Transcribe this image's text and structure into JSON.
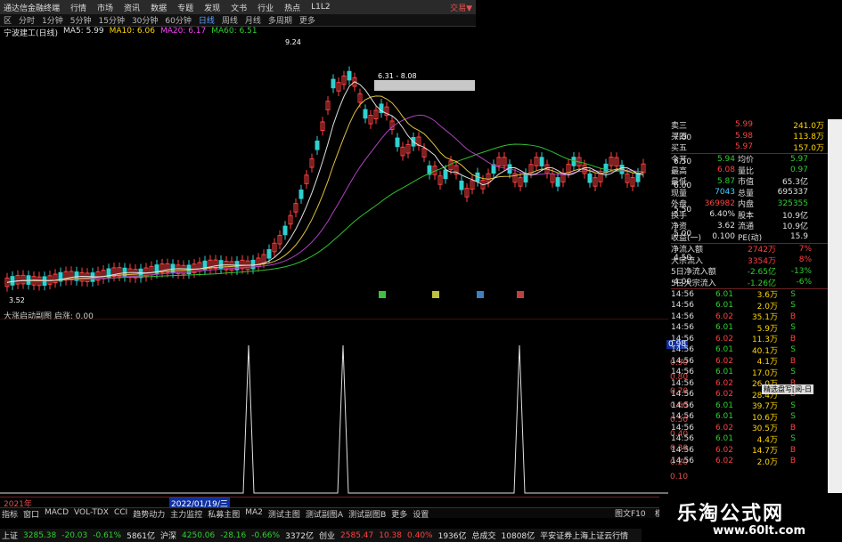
{
  "titlebar": {
    "app": "通达信金融终端",
    "menus": [
      "行情",
      "市场",
      "资讯",
      "数据",
      "专题",
      "发现",
      "文书",
      "行业",
      "热点",
      "L1L2"
    ],
    "right": "交易▼"
  },
  "toolbar": {
    "items": [
      "区",
      "分时",
      "1分钟",
      "5分钟",
      "15分钟",
      "30分钟",
      "60分钟",
      "日线",
      "周线",
      "月线",
      "多周期",
      "更多"
    ],
    "active": "日线"
  },
  "legend": {
    "stock": "宁波建工(日线)",
    "ma5": "MA5: 5.99",
    "ma10": "MA10: 6.06",
    "ma20": "MA20: 6.17",
    "ma60": "MA60: 6.51"
  },
  "annotations": {
    "high": "9.24",
    "low": "3.52",
    "range": "6.31 - 8.08"
  },
  "price_ticks": [
    "7.00",
    "6.50",
    "6.00",
    "5.50",
    "5.00",
    "4.50",
    "4.00"
  ],
  "sub_legend": "大涨启动副图  启涨: 0.00",
  "sub_ticks": [
    "0.98",
    "0.90",
    "0.80",
    "0.70",
    "0.60",
    "0.50",
    "0.40",
    "0.30",
    "0.20",
    "0.10"
  ],
  "sub_current": "0.98",
  "timeline": {
    "start": "2021年",
    "cursor": "2022/01/19/三"
  },
  "bottom_tabs": [
    "指标",
    "窗口",
    "MACD",
    "VOL-TDX",
    "CCI",
    "趋势动力",
    "主力监控",
    "私募主图",
    "MA2",
    "测试主图",
    "测试副图A",
    "测试副图B",
    "更多",
    "设置"
  ],
  "quote": {
    "ask3": {
      "label": "卖三",
      "price": "5.99",
      "vol": "241.0万"
    },
    "ask4": {
      "label": "买四",
      "price": "5.98",
      "vol": "113.8万"
    },
    "ask5": {
      "label": "买五",
      "price": "5.97",
      "vol": "157.0万"
    },
    "rows": [
      {
        "l1": "今开",
        "v1": "5.94",
        "c1": "green",
        "l2": "均价",
        "v2": "5.97",
        "c2": "green"
      },
      {
        "l1": "最高",
        "v1": "6.08",
        "c1": "red",
        "l2": "量比",
        "v2": "0.97",
        "c2": "green"
      },
      {
        "l1": "最低",
        "v1": "5.87",
        "c1": "green",
        "l2": "市值",
        "v2": "65.3亿",
        "c2": "white"
      },
      {
        "l1": "现量",
        "v1": "7043",
        "c1": "cyan",
        "l2": "总量",
        "v2": "695337",
        "c2": "white"
      },
      {
        "l1": "外盘",
        "v1": "369982",
        "c1": "red",
        "l2": "内盘",
        "v2": "325355",
        "c2": "green"
      },
      {
        "l1": "换手",
        "v1": "6.40%",
        "c1": "white",
        "l2": "股本",
        "v2": "10.9亿",
        "c2": "white"
      },
      {
        "l1": "净资",
        "v1": "3.62",
        "c1": "white",
        "l2": "流通",
        "v2": "10.9亿",
        "c2": "white"
      },
      {
        "l1": "收益(一)",
        "v1": "0.100",
        "c1": "white",
        "l2": "PE(动)",
        "v2": "15.9",
        "c2": "white"
      }
    ],
    "flow": [
      {
        "label": "净流入额",
        "value": "2742万",
        "pct": "7%",
        "color": "red"
      },
      {
        "label": "大宗流入",
        "value": "3354万",
        "pct": "8%",
        "color": "red"
      },
      {
        "label": "5日净流入额",
        "value": "-2.65亿",
        "pct": "-13%",
        "color": "green"
      },
      {
        "label": "5日大宗流入",
        "value": "-1.26亿",
        "pct": "-6%",
        "color": "green"
      }
    ],
    "ticks": [
      {
        "t": "14:56",
        "p": "6.01",
        "v": "3.6万",
        "s": "S"
      },
      {
        "t": "14:56",
        "p": "6.01",
        "v": "2.0万",
        "s": "S"
      },
      {
        "t": "14:56",
        "p": "6.02",
        "v": "35.1万",
        "s": "B"
      },
      {
        "t": "14:56",
        "p": "6.01",
        "v": "5.9万",
        "s": "S"
      },
      {
        "t": "14:56",
        "p": "6.02",
        "v": "11.3万",
        "s": "B"
      },
      {
        "t": "14:56",
        "p": "6.01",
        "v": "40.1万",
        "s": "S"
      },
      {
        "t": "14:56",
        "p": "6.02",
        "v": "4.1万",
        "s": "B"
      },
      {
        "t": "14:56",
        "p": "6.01",
        "v": "17.0万",
        "s": "S"
      },
      {
        "t": "14:56",
        "p": "6.02",
        "v": "26.0万",
        "s": "B"
      },
      {
        "t": "14:56",
        "p": "6.02",
        "v": "28.4万",
        "s": "B"
      },
      {
        "t": "14:56",
        "p": "6.01",
        "v": "39.7万",
        "s": "S"
      },
      {
        "t": "14:56",
        "p": "6.01",
        "v": "10.6万",
        "s": "S"
      },
      {
        "t": "14:56",
        "p": "6.02",
        "v": "30.5万",
        "s": "B"
      },
      {
        "t": "14:56",
        "p": "6.01",
        "v": "4.4万",
        "s": "S"
      },
      {
        "t": "14:56",
        "p": "6.02",
        "v": "14.7万",
        "s": "B"
      },
      {
        "t": "14:56",
        "p": "6.02",
        "v": "2.0万",
        "s": "B"
      }
    ]
  },
  "tooltip": "精选盘写[阅-日",
  "status": {
    "sh_label": "上证",
    "sh_val": "3285.38",
    "sh_chg": "-20.03",
    "sh_pct": "-0.61%",
    "sh_amt": "5861亿",
    "sz_label": "沪深",
    "sz_val": "4250.06",
    "sz_chg": "-28.16",
    "sz_pct": "-0.66%",
    "sz_amt": "3372亿",
    "cy_label": "创业",
    "cy_val": "2585.47",
    "cy_chg": "10.38",
    "cy_pct": "0.40%",
    "cy_amt": "1936亿",
    "total_label": "总成交",
    "total_val": "10808亿",
    "news": "平安证券上海上证云行情"
  },
  "side_tabs": [
    "图文F10",
    "模板"
  ],
  "watermark": {
    "title": "乐淘公式网",
    "url": "www.60lt.com"
  },
  "signal_markers": [
    "B",
    "B",
    "B",
    "B"
  ]
}
